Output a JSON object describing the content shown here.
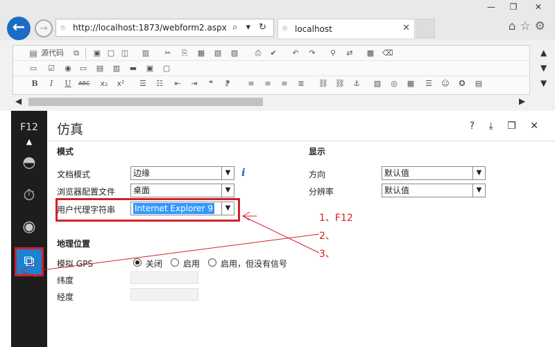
{
  "window": {
    "minimize": "—",
    "restore": "❐",
    "close": "✕"
  },
  "nav": {
    "back": "←",
    "forward": "→"
  },
  "address": {
    "url": "http://localhost:1873/webform2.aspx",
    "controls": "⌕ ▾ ↻"
  },
  "tab": {
    "title": "localhost",
    "close": "✕"
  },
  "browser_icons": {
    "home": "⌂",
    "favorites": "☆",
    "settings": "⚙"
  },
  "toolbar": {
    "source_label": "源代码",
    "row1_icons": [
      "cut-icon",
      "copy-icon",
      "paste-icon",
      "undo-icon",
      "redo-icon",
      "find-icon"
    ],
    "bold": "B",
    "italic": "I",
    "underline": "U",
    "strike": "ABC",
    "subscript": "x₂",
    "superscript": "x²"
  },
  "f12": {
    "label": "F12"
  },
  "devpanel": {
    "title": "仿真",
    "tool_help": "?",
    "tool_dock": "⤓",
    "tool_undock": "❐",
    "tool_close": "✕",
    "mode_section": "模式",
    "doc_mode_label": "文档模式",
    "doc_mode_value": "边缘",
    "browser_profile_label": "浏览器配置文件",
    "browser_profile_value": "桌面",
    "ua_label": "用户代理字符串",
    "ua_value": "Internet Explorer 9",
    "display_section": "显示",
    "orientation_label": "方向",
    "orientation_value": "默认值",
    "resolution_label": "分辨率",
    "resolution_value": "默认值",
    "geo_section": "地理位置",
    "gps_label": "模拟 GPS",
    "gps_off": "关闭",
    "gps_on": "启用",
    "gps_no_signal": "启用，但没有信号",
    "lat_label": "纬度",
    "lon_label": "经度"
  },
  "annotations": {
    "step1": "1、F12",
    "step2": "2、",
    "step3": "3、"
  },
  "colors": {
    "accent": "#1982d2",
    "annotation": "#d0202b",
    "sidebar": "#1d1d1d"
  }
}
